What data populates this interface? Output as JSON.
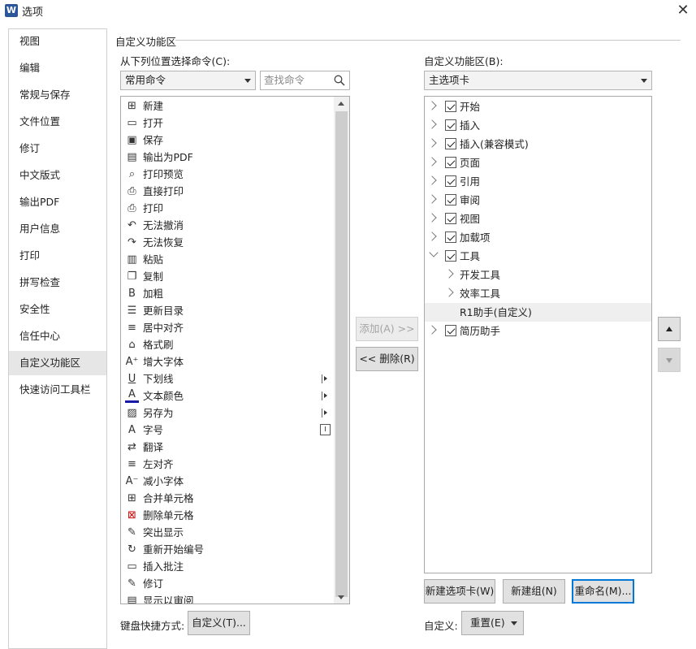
{
  "window": {
    "title": "选项",
    "app_icon": "W",
    "close_symbol": "✕"
  },
  "nav": {
    "items": [
      {
        "label": "视图"
      },
      {
        "label": "编辑"
      },
      {
        "label": "常规与保存"
      },
      {
        "label": "文件位置"
      },
      {
        "label": "修订"
      },
      {
        "label": "中文版式"
      },
      {
        "label": "输出PDF"
      },
      {
        "label": "用户信息"
      },
      {
        "label": "打印"
      },
      {
        "label": "拼写检查"
      },
      {
        "label": "安全性"
      },
      {
        "label": "信任中心"
      },
      {
        "label": "自定义功能区"
      },
      {
        "label": "快速访问工具栏"
      }
    ],
    "selected": "自定义功能区"
  },
  "section": {
    "title": "自定义功能区"
  },
  "left": {
    "choose_label": "从下列位置选择命令(C):",
    "source_value": "常用命令",
    "search_placeholder": "查找命令",
    "commands": [
      {
        "label": "新建",
        "icon": "new-document-icon",
        "glyph": "⊞"
      },
      {
        "label": "打开",
        "icon": "open-folder-icon",
        "glyph": "▭"
      },
      {
        "label": "保存",
        "icon": "save-icon",
        "glyph": "▣"
      },
      {
        "label": "输出为PDF",
        "icon": "pdf-icon",
        "glyph": "▤"
      },
      {
        "label": "打印预览",
        "icon": "print-preview-icon",
        "glyph": "⌕"
      },
      {
        "label": "直接打印",
        "icon": "direct-print-icon",
        "glyph": "⎙"
      },
      {
        "label": "打印",
        "icon": "print-icon",
        "glyph": "⎙"
      },
      {
        "label": "无法撤消",
        "icon": "undo-icon",
        "glyph": "↶"
      },
      {
        "label": "无法恢复",
        "icon": "redo-icon",
        "glyph": "↷"
      },
      {
        "label": "粘贴",
        "icon": "paste-icon",
        "glyph": "▥"
      },
      {
        "label": "复制",
        "icon": "copy-icon",
        "glyph": "❐"
      },
      {
        "label": "加粗",
        "icon": "bold-icon",
        "glyph": "B"
      },
      {
        "label": "更新目录",
        "icon": "update-toc-icon",
        "glyph": "☰"
      },
      {
        "label": "居中对齐",
        "icon": "align-center-icon",
        "glyph": "≡"
      },
      {
        "label": "格式刷",
        "icon": "format-painter-icon",
        "glyph": "⌂"
      },
      {
        "label": "增大字体",
        "icon": "grow-font-icon",
        "glyph": "A⁺"
      },
      {
        "label": "下划线",
        "icon": "underline-icon",
        "glyph": "U",
        "submenu": true
      },
      {
        "label": "文本颜色",
        "icon": "font-color-icon",
        "glyph": "A",
        "submenu": true
      },
      {
        "label": "另存为",
        "icon": "save-as-icon",
        "glyph": "▨",
        "submenu": true
      },
      {
        "label": "字号",
        "icon": "font-size-icon",
        "glyph": "A",
        "spinner": true
      },
      {
        "label": "翻译",
        "icon": "translate-icon",
        "glyph": "⇄"
      },
      {
        "label": "左对齐",
        "icon": "align-left-icon",
        "glyph": "≡"
      },
      {
        "label": "减小字体",
        "icon": "shrink-font-icon",
        "glyph": "A⁻"
      },
      {
        "label": "合并单元格",
        "icon": "merge-cells-icon",
        "glyph": "⊞"
      },
      {
        "label": "删除单元格",
        "icon": "delete-cells-icon",
        "glyph": "⊠"
      },
      {
        "label": "突出显示",
        "icon": "highlight-icon",
        "glyph": "✎"
      },
      {
        "label": "重新开始编号",
        "icon": "restart-numbering-icon",
        "glyph": "↻"
      },
      {
        "label": "插入批注",
        "icon": "insert-comment-icon",
        "glyph": "▭"
      },
      {
        "label": "修订",
        "icon": "track-changes-icon",
        "glyph": "✎"
      },
      {
        "label": "显示以审阅",
        "icon": "display-for-review-icon",
        "glyph": "▤"
      }
    ]
  },
  "middle": {
    "add_label": "添加(A) >>",
    "remove_label": "<< 删除(R)"
  },
  "right": {
    "customize_label": "自定义功能区(B):",
    "tabs_value": "主选项卡",
    "tree": [
      {
        "label": "开始",
        "level": 0,
        "expander": "closed",
        "checked": true
      },
      {
        "label": "插入",
        "level": 0,
        "expander": "closed",
        "checked": true
      },
      {
        "label": "插入(兼容模式)",
        "level": 0,
        "expander": "closed",
        "checked": true
      },
      {
        "label": "页面",
        "level": 0,
        "expander": "closed",
        "checked": true
      },
      {
        "label": "引用",
        "level": 0,
        "expander": "closed",
        "checked": true
      },
      {
        "label": "审阅",
        "level": 0,
        "expander": "closed",
        "checked": true
      },
      {
        "label": "视图",
        "level": 0,
        "expander": "closed",
        "checked": true
      },
      {
        "label": "加载项",
        "level": 0,
        "expander": "closed",
        "checked": true
      },
      {
        "label": "工具",
        "level": 0,
        "expander": "open",
        "checked": true
      },
      {
        "label": "开发工具",
        "level": 1,
        "expander": "closed",
        "checked": false
      },
      {
        "label": "效率工具",
        "level": 1,
        "expander": "closed",
        "checked": false
      },
      {
        "label": "R1助手(自定义)",
        "level": 1,
        "expander": "none",
        "checked": false,
        "selected": true
      },
      {
        "label": "简历助手",
        "level": 0,
        "expander": "closed",
        "checked": true
      }
    ],
    "new_tab_label": "新建选项卡(W)",
    "new_group_label": "新建组(N)",
    "rename_label": "重命名(M)...",
    "customizations_label": "自定义:",
    "reset_label": "重置(E)"
  },
  "footer": {
    "keyboard_label": "键盘快捷方式:",
    "keyboard_button_label": "自定义(T)..."
  },
  "colors": {
    "accent": "#0078d7",
    "nav_selected": "#e6e6e6",
    "button_face": "#e1e1e1",
    "app_icon": "#2b579a"
  }
}
